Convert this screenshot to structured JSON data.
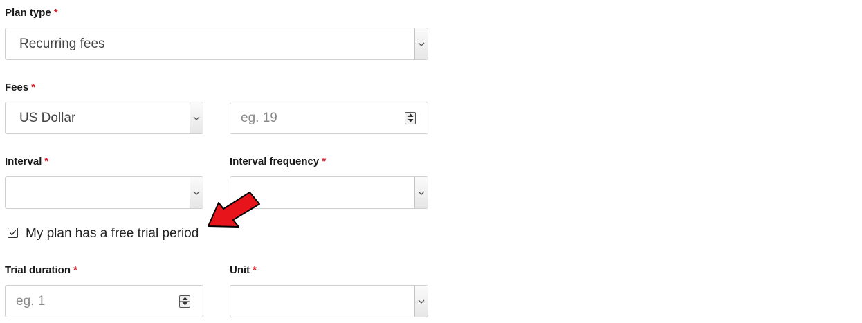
{
  "form": {
    "required_marker": "*",
    "plan_type": {
      "label": "Plan type",
      "value": "Recurring fees"
    },
    "fees": {
      "label": "Fees",
      "currency_value": "US Dollar",
      "amount_placeholder": "eg. 19"
    },
    "interval": {
      "label": "Interval",
      "value": ""
    },
    "interval_frequency": {
      "label": "Interval frequency",
      "value": ""
    },
    "free_trial": {
      "label": "My plan has a free trial period",
      "checked": true
    },
    "trial_duration": {
      "label": "Trial duration",
      "placeholder": "eg. 1"
    },
    "unit": {
      "label": "Unit",
      "value": ""
    }
  },
  "colors": {
    "required": "#d9232d",
    "annotation_arrow": "#e8141c",
    "border": "#cfcfcf"
  }
}
